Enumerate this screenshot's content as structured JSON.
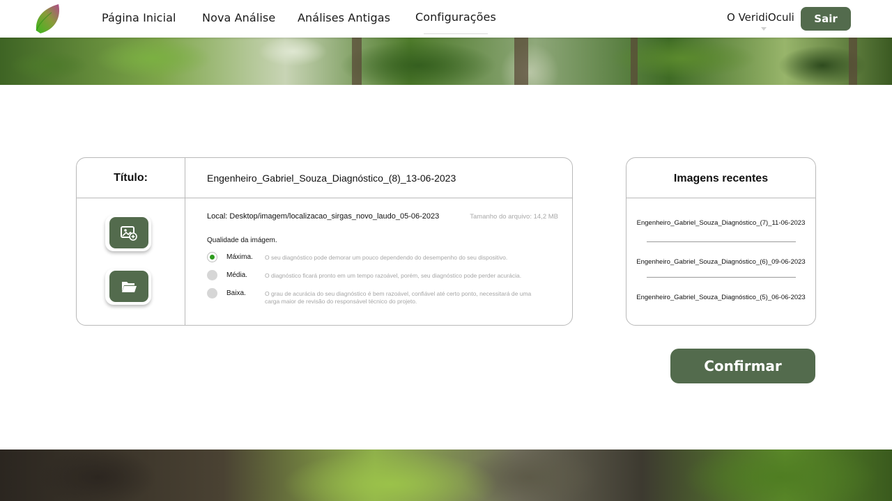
{
  "nav": {
    "home": "Página Inicial",
    "new_analysis": "Nova Análise",
    "old_analyses": "Análises Antigas",
    "settings": "Configurações",
    "about": "O VeridiOculi",
    "logout": "Sair"
  },
  "colors": {
    "accent": "#536b4d",
    "radio_selected": "#2e9b1f"
  },
  "form": {
    "title_label": "Título:",
    "title_value": "Engenheiro_Gabriel_Souza_Diagnóstico_(8)_13-06-2023",
    "upload_image_icon": "add-image-icon",
    "open_folder_icon": "folder-open-icon",
    "local_path": "Local: Desktop/imagem/localizacao_sirgas_novo_laudo_05-06-2023",
    "file_size": "Tamanho do arquivo: 14,2 MB",
    "quality_label": "Qualidade da imágem.",
    "quality_selected": "Máxima.",
    "quality_options": [
      {
        "label": "Máxima.",
        "description": "O seu diagnóstico pode demorar um pouco dependendo do desempenho do seu dispositivo."
      },
      {
        "label": "Média.",
        "description": "O diagnóstico ficará pronto em um tempo razoável, porém, seu diagnóstico pode perder acurácia."
      },
      {
        "label": "Baixa.",
        "description": "O grau de acurácia do seu diagnóstico é bem razoável, confiável até certo ponto, necessitará de uma carga maior de revisão do responsável técnico do projeto."
      }
    ]
  },
  "recent": {
    "title": "Imagens recentes",
    "items": [
      "Engenheiro_Gabriel_Souza_Diagnóstico_(7)_11-06-2023",
      "Engenheiro_Gabriel_Souza_Diagnóstico_(6)_09-06-2023",
      "Engenheiro_Gabriel_Souza_Diagnóstico_(5)_06-06-2023"
    ]
  },
  "confirm_label": "Confirmar"
}
